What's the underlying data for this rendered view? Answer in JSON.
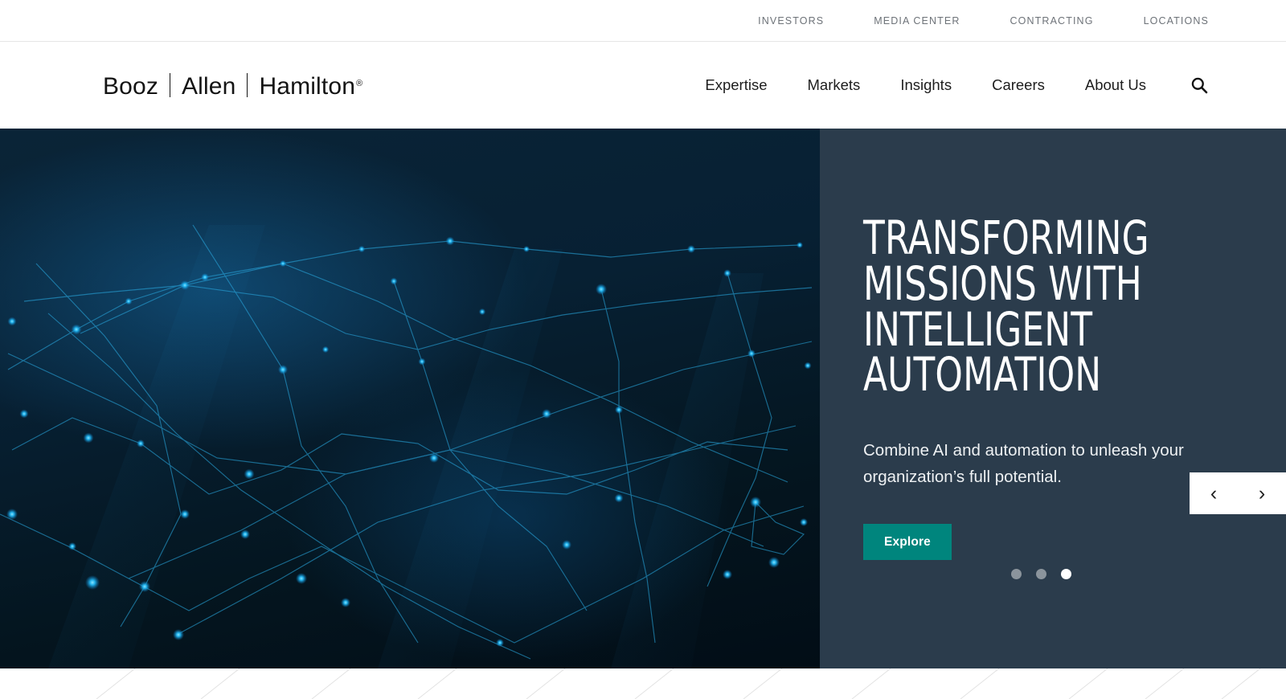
{
  "utility_nav": {
    "items": [
      {
        "label": "INVESTORS"
      },
      {
        "label": "MEDIA CENTER"
      },
      {
        "label": "CONTRACTING"
      },
      {
        "label": "LOCATIONS"
      }
    ]
  },
  "header": {
    "logo": {
      "part1": "Booz",
      "part2": "Allen",
      "part3": "Hamilton",
      "registered": "®"
    },
    "nav": [
      {
        "label": "Expertise"
      },
      {
        "label": "Markets"
      },
      {
        "label": "Insights"
      },
      {
        "label": "Careers"
      },
      {
        "label": "About Us"
      }
    ],
    "search_icon": "search-icon"
  },
  "hero": {
    "title": "TRANSFORMING\nMISSIONS WITH\nINTELLIGENT\nAUTOMATION",
    "subtitle": "Combine AI and automation to unleash your organization’s full potential.",
    "cta_label": "Explore",
    "prev_label": "‹",
    "next_label": "›",
    "slides": [
      {
        "active": false
      },
      {
        "active": false
      },
      {
        "active": true
      }
    ],
    "colors": {
      "panel_bg": "#2b3c4c",
      "cta_bg": "#00857d",
      "active_dot": "#ffffff",
      "inactive_dot": "#8b949c"
    }
  }
}
